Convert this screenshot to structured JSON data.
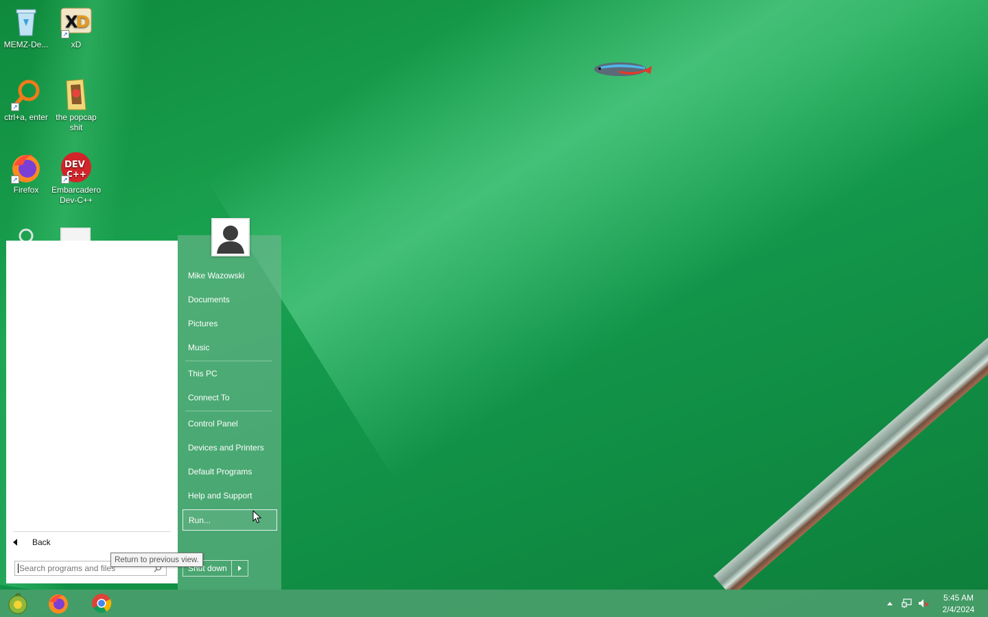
{
  "desktop": {
    "icons": [
      {
        "label": "MEMZ-De..."
      },
      {
        "label": "xD"
      },
      {
        "label": "ctrl+a, enter"
      },
      {
        "label": "the popcap shit"
      },
      {
        "label": "Firefox"
      },
      {
        "label": "Embarcadero Dev-C++"
      }
    ]
  },
  "start_menu": {
    "back_label": "Back",
    "search_placeholder": "Search programs and files",
    "tooltip": "Return to previous view.",
    "user_name": "Mike Wazowski",
    "items": [
      {
        "label": "Documents"
      },
      {
        "label": "Pictures"
      },
      {
        "label": "Music"
      },
      {
        "label": "This PC"
      },
      {
        "label": "Connect To"
      },
      {
        "label": "Control Panel"
      },
      {
        "label": "Devices and Printers"
      },
      {
        "label": "Default Programs"
      },
      {
        "label": "Help and Support"
      },
      {
        "label": "Run..."
      }
    ],
    "shutdown_label": "Shut down"
  },
  "taskbar": {
    "pinned": [
      {
        "icon": "start-orb-icon"
      },
      {
        "icon": "firefox-icon"
      },
      {
        "icon": "chrome-icon"
      }
    ],
    "clock": {
      "time": "5:45 AM",
      "date": "2/4/2024"
    }
  },
  "colors": {
    "wallpaper": "#1aa350",
    "menu_right": "#6eb48c",
    "taskbar": "#4ea06e"
  }
}
